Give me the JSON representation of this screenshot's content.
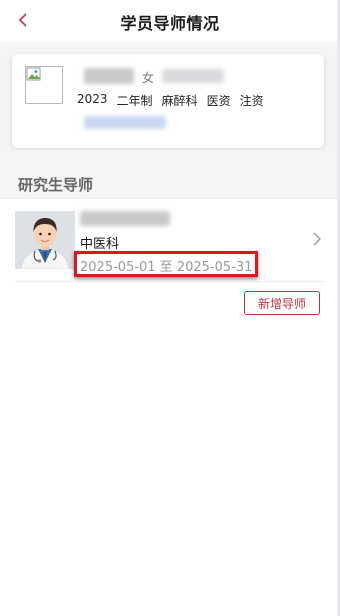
{
  "header": {
    "title": "学员导师情况",
    "back_icon": "chevron-left-icon",
    "accent_color": "#c0333d"
  },
  "student": {
    "gender": "女",
    "tags": [
      "2023",
      "二年制",
      "麻醉科",
      "医资",
      "注资"
    ]
  },
  "tutor_section": {
    "title": "研究生导师",
    "tutors": [
      {
        "department": "中医科",
        "period": "2025-05-01 至 2025-05-31",
        "avatar_icon": "doctor-avatar-icon"
      }
    ],
    "add_button_label": "新增导师"
  }
}
